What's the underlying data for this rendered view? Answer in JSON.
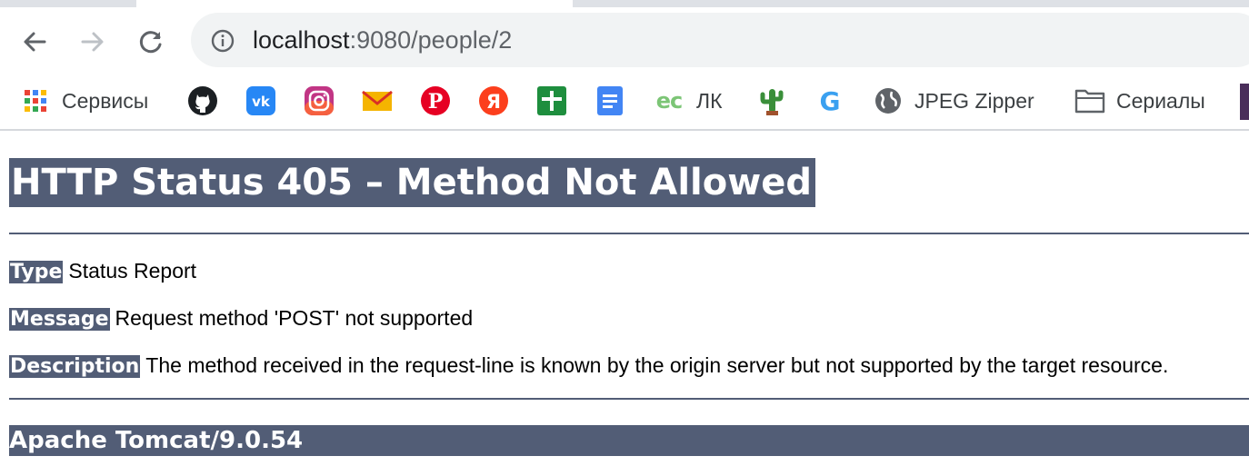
{
  "browser": {
    "url_host": "localhost",
    "url_path": ":9080/people/2"
  },
  "bookmarks": [
    {
      "label": "Сервисы",
      "icon": "apps-grid-icon"
    },
    {
      "label": "",
      "icon": "github-icon"
    },
    {
      "label": "",
      "icon": "vk-icon"
    },
    {
      "label": "",
      "icon": "instagram-icon"
    },
    {
      "label": "",
      "icon": "mail-icon"
    },
    {
      "label": "",
      "icon": "pinterest-icon"
    },
    {
      "label": "",
      "icon": "yandex-icon"
    },
    {
      "label": "",
      "icon": "sheets-icon"
    },
    {
      "label": "",
      "icon": "docs-icon"
    },
    {
      "label": "ЛК",
      "icon": "ec-icon",
      "icon_text": "ec"
    },
    {
      "label": "",
      "icon": "cactus-icon"
    },
    {
      "label": "",
      "icon": "g-icon"
    },
    {
      "label": "JPEG Zipper",
      "icon": "globe-icon"
    },
    {
      "label": "Сериалы",
      "icon": "folder-icon"
    }
  ],
  "page": {
    "title": "HTTP Status 405 – Method Not Allowed",
    "type_key": "Type",
    "type_value": "Status Report",
    "message_key": "Message",
    "message_value": "Request method 'POST' not supported",
    "description_key": "Description",
    "description_value": "The method received in the request-line is known by the origin server but not supported by the target resource.",
    "footer": "Apache Tomcat/9.0.54"
  },
  "colors": {
    "header_bg": "#525d76",
    "header_text": "#ffffff"
  }
}
